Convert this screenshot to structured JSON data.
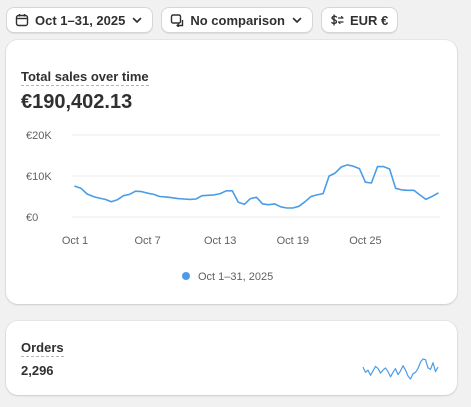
{
  "toolbar": {
    "date_label": "Oct 1–31, 2025",
    "comparison_label": "No comparison",
    "currency_label": "EUR €"
  },
  "icons": {
    "calendar": "calendar-icon",
    "compare": "compare-icon",
    "currency": "currency-swap-icon",
    "chevron": "chevron-down-icon"
  },
  "colors": {
    "series": "#4b9ce8",
    "page_background": "#f1f1f1",
    "card_background": "#ffffff"
  },
  "sales_card": {
    "title": "Total sales over time",
    "total": "€190,402.13",
    "legend_label": "Oct 1–31, 2025"
  },
  "orders_card": {
    "title": "Orders",
    "total": "2,296"
  },
  "chart_data": [
    {
      "type": "line",
      "title": "",
      "xlabel": "",
      "ylabel": "",
      "ylim": [
        0,
        20000
      ],
      "y_ticks": [
        0,
        10000,
        20000
      ],
      "y_tick_labels": [
        "€0",
        "€10K",
        "€20K"
      ],
      "x_ticks": [
        1,
        7,
        13,
        19,
        25
      ],
      "x_tick_labels": [
        "Oct 1",
        "Oct 7",
        "Oct 13",
        "Oct 19",
        "Oct 25"
      ],
      "grid": true,
      "legend_position": "bottom",
      "series": [
        {
          "name": "Oct 1–31, 2025",
          "x": [
            1,
            1.5,
            2,
            2.5,
            3,
            3.5,
            4,
            4.5,
            5,
            5.5,
            6,
            6.5,
            7,
            7.5,
            8,
            8.5,
            9,
            9.5,
            10,
            10.5,
            11,
            11.5,
            12,
            12.5,
            13,
            13.5,
            14,
            14.5,
            15,
            15.5,
            16,
            16.5,
            17,
            17.5,
            18,
            18.5,
            19,
            19.5,
            20,
            20.5,
            21,
            21.5,
            22,
            22.5,
            23,
            23.5,
            24,
            24.5,
            25,
            25.5,
            26,
            26.5,
            27,
            27.5,
            28,
            28.5,
            29,
            29.5,
            30,
            30.5,
            31
          ],
          "values": [
            7500,
            7000,
            5600,
            5000,
            4600,
            4300,
            3700,
            4200,
            5200,
            5500,
            6300,
            6200,
            5800,
            5500,
            5000,
            4900,
            4700,
            4500,
            4400,
            4300,
            4400,
            5200,
            5300,
            5400,
            5700,
            6400,
            6400,
            3600,
            3100,
            4500,
            4800,
            3200,
            3000,
            3200,
            2500,
            2200,
            2200,
            2600,
            3700,
            5000,
            5400,
            5700,
            10000,
            10700,
            12200,
            12700,
            12400,
            11800,
            8500,
            8300,
            12300,
            12300,
            11700,
            7000,
            6600,
            6500,
            6500,
            5400,
            4300,
            5000,
            5800
          ]
        }
      ]
    },
    {
      "type": "line",
      "title": "",
      "xlabel": "",
      "ylabel": "",
      "grid": false,
      "series": [
        {
          "values": [
            62,
            55,
            58,
            51,
            57,
            63,
            60,
            54,
            58,
            61,
            56,
            49,
            55,
            60,
            52,
            57,
            64,
            58,
            50,
            46,
            53,
            55,
            60,
            69,
            73,
            72,
            61,
            59,
            68,
            56,
            62
          ]
        }
      ]
    }
  ]
}
